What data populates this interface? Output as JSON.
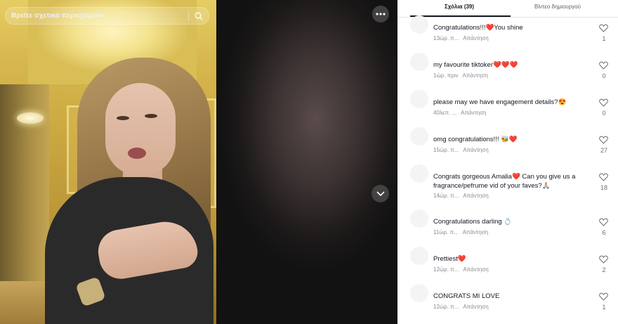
{
  "search": {
    "placeholder": "Βρείτε σχετικό περιεχόμενο",
    "icon": "search-icon"
  },
  "video": {
    "more_icon": "more-horizontal-icon",
    "next_icon": "chevron-down-icon"
  },
  "tabs": [
    {
      "label": "Σχόλια (39)",
      "active": true
    },
    {
      "label": "Βίντεο δημιουργού",
      "active": false
    }
  ],
  "reply_label": "Απάντηση",
  "comments": [
    {
      "text": "Congratulations!!!❤️You shine",
      "time": "13ώρ. π...",
      "likes": "1"
    },
    {
      "text": "my favourite tiktoker❤️❤️❤️",
      "time": "1ώρ. πριν",
      "likes": "0"
    },
    {
      "text": "please may we have engagement details?😍",
      "time": "40λεπ. ...",
      "likes": "0"
    },
    {
      "text": "omg congratulations!!! 🐝❤️",
      "time": "15ώρ. π...",
      "likes": "27"
    },
    {
      "text": "Congrats gorgeous Amalia❤️ Can you give us a fragrance/pefrume vid of your faves?🙏🏼",
      "time": "14ώρ. π...",
      "likes": "18"
    },
    {
      "text": "Congratulations darling 💍",
      "time": "11ώρ. π...",
      "likes": "6"
    },
    {
      "text": "Prettiest❤️",
      "time": "12ώρ. π...",
      "likes": "2"
    },
    {
      "text": "CONGRATS MI LOVE",
      "time": "12ώρ. π...",
      "likes": "1"
    }
  ],
  "colors": {
    "accent": "#161823",
    "like_heart": "#e8343e",
    "muted": "#8a8b91"
  }
}
